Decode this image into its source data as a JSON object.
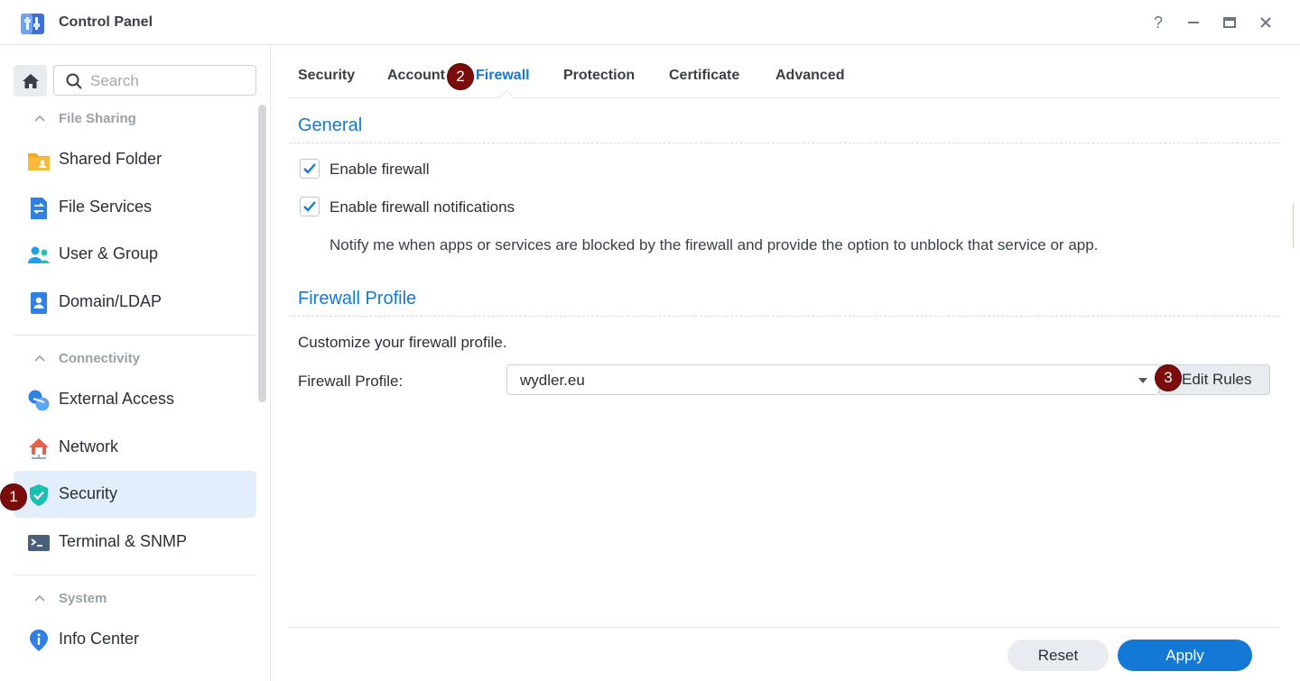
{
  "window": {
    "title": "Control Panel",
    "help_glyph": "?",
    "minimize_glyph": "—",
    "maximize_glyph": "▭",
    "close_glyph": "✕"
  },
  "sidebar": {
    "search_placeholder": "Search",
    "categories": [
      {
        "label": "File Sharing",
        "items": [
          "Shared Folder",
          "File Services",
          "User & Group",
          "Domain/LDAP"
        ]
      },
      {
        "label": "Connectivity",
        "items": [
          "External Access",
          "Network",
          "Security",
          "Terminal & SNMP"
        ]
      },
      {
        "label": "System",
        "items": [
          "Info Center"
        ]
      }
    ],
    "active_item": "Security"
  },
  "badges": {
    "one": "1",
    "two": "2",
    "three": "3"
  },
  "tabs": [
    {
      "label": "Security",
      "active": false
    },
    {
      "label": "Account",
      "active": false
    },
    {
      "label": "Firewall",
      "active": true
    },
    {
      "label": "Protection",
      "active": false
    },
    {
      "label": "Certificate",
      "active": false
    },
    {
      "label": "Advanced",
      "active": false
    }
  ],
  "general": {
    "title": "General",
    "enable_firewall": {
      "label": "Enable firewall",
      "checked": true
    },
    "enable_notifications": {
      "label": "Enable firewall notifications",
      "checked": true
    },
    "notification_hint": "Notify me when apps or services are blocked by the firewall and provide the option to unblock that service or app."
  },
  "profile": {
    "title": "Firewall Profile",
    "description": "Customize your firewall profile.",
    "field_label": "Firewall Profile:",
    "selected_value": "wydler.eu",
    "edit_button": "Edit Rules"
  },
  "footer": {
    "reset_label": "Reset",
    "apply_label": "Apply"
  },
  "colors": {
    "accent": "#1479d6",
    "active_bg": "#e2eefb",
    "badge": "#7a0c0c"
  }
}
